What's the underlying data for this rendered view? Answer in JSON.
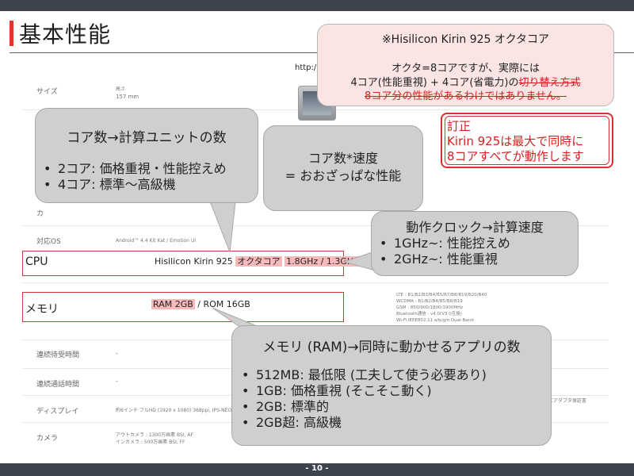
{
  "slide": {
    "title": "基本性能",
    "page_number": "- 10 -"
  },
  "source_url": "http:/",
  "spec_table": {
    "size_label": "サイズ",
    "size_sub": "高さ",
    "size_value": "157 mm",
    "camera_partial": "カ",
    "os_label": "対応OS",
    "os_value": "Android™ 4.4 Kit Kat / Emotion UI",
    "cpu_label": "CPU",
    "cpu_prefix": "Hisilicon Kirin 925 ",
    "cpu_octa": "オクタコア",
    "cpu_sep": " ",
    "cpu_clock": "1.8GHz / 1.3GHz",
    "memory_label": "メモリ",
    "memory_ram": "RAM 2GB",
    "memory_rest": " / ROM 16GB",
    "network_lines": [
      "LTE : B1/B2/B3/B4/B5/B7/B8/B19/B20/B40",
      "WCDMA : B1/B2/B4/B5/B8/B19",
      "GSM : 850/900/1800/1900MHz",
      "Bluetooth通信 : v4.0(V3.0互換)",
      "Wi-Fi IEEE802.11 a/b/g/n Dual-Band"
    ],
    "standby_label": "連続待受時間",
    "standby_value": "-",
    "talk_label": "連続通話時間",
    "talk_value": "-",
    "display_label": "ディスプレイ",
    "display_value": "約6インチ フルHD (1920 x 1080) 368ppi, IPS-NEO™",
    "display_right": "9 / ACアダプタ保証書",
    "camera_label": "カメラ",
    "camera_values": [
      "アウトカメラ : 1300万画素 BSI, AF",
      "インカメラ : 500万画素 BSI, FF"
    ]
  },
  "callout_kirin": {
    "title": "※Hisilicon Kirin 925 オクタコア",
    "line1": "オクタ=8コアですが、実際には",
    "line2_prefix": "4コア(性能重視) + 4コア(省電力)の",
    "line2_struck": "切り替え方式",
    "line3_struck": "8コア分の性能があるわけではありません。"
  },
  "callout_correction": {
    "title": "訂正",
    "line1": "Kirin 925は最大で同時に",
    "line2": "8コアすべてが動作します"
  },
  "callout_cores": {
    "title": "コア数→計算ユニットの数",
    "items": [
      "2コア: 価格重視・性能控えめ",
      "4コア: 標準〜高級機"
    ]
  },
  "callout_perf": {
    "line1": "コア数*速度",
    "line2": "= おおざっぱな性能"
  },
  "callout_clock": {
    "title": "動作クロック→計算速度",
    "items": [
      "1GHz~: 性能控えめ",
      "2GHz~: 性能重視"
    ]
  },
  "callout_memory": {
    "title": "メモリ (RAM)→同時に動かせるアプリの数",
    "items": [
      "512MB: 最低限 (工夫して使う必要あり)",
      "1GB: 価格重視 (そこそこ動く)",
      "2GB: 標準的",
      "2GB超: 高級機"
    ]
  },
  "colors": {
    "accent_red": "#e0392a",
    "bubble_gray": "#cfcfcf",
    "highlight_pink": "#f7b9b9",
    "bar_dark": "#3d4450"
  }
}
